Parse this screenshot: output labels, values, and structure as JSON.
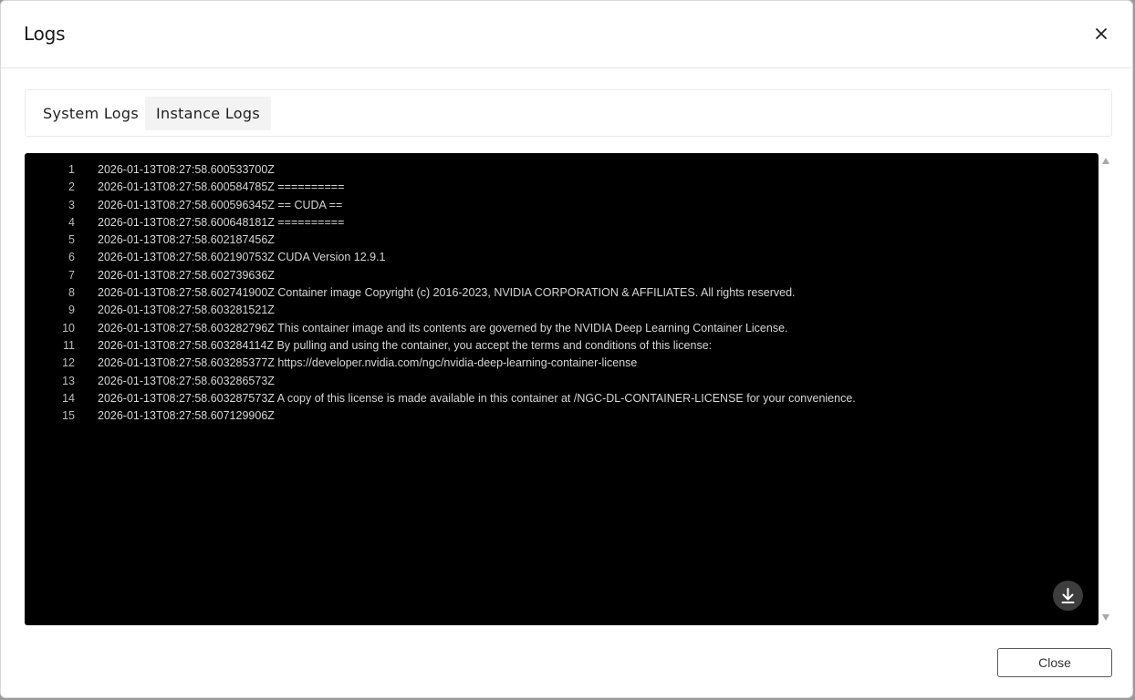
{
  "dialog": {
    "title": "Logs",
    "close_icon": "close-icon"
  },
  "tabs": [
    {
      "label": "System Logs",
      "active": false
    },
    {
      "label": "Instance Logs",
      "active": true
    }
  ],
  "console": {
    "lines": [
      {
        "n": "1",
        "text": "2026-01-13T08:27:58.600533700Z"
      },
      {
        "n": "2",
        "text": "2026-01-13T08:27:58.600584785Z =========="
      },
      {
        "n": "3",
        "text": "2026-01-13T08:27:58.600596345Z == CUDA =="
      },
      {
        "n": "4",
        "text": "2026-01-13T08:27:58.600648181Z =========="
      },
      {
        "n": "5",
        "text": "2026-01-13T08:27:58.602187456Z"
      },
      {
        "n": "6",
        "text": "2026-01-13T08:27:58.602190753Z CUDA Version 12.9.1"
      },
      {
        "n": "7",
        "text": "2026-01-13T08:27:58.602739636Z"
      },
      {
        "n": "8",
        "text": "2026-01-13T08:27:58.602741900Z Container image Copyright (c) 2016-2023, NVIDIA CORPORATION & AFFILIATES. All rights reserved."
      },
      {
        "n": "9",
        "text": "2026-01-13T08:27:58.603281521Z"
      },
      {
        "n": "10",
        "text": "2026-01-13T08:27:58.603282796Z This container image and its contents are governed by the NVIDIA Deep Learning Container License."
      },
      {
        "n": "11",
        "text": "2026-01-13T08:27:58.603284114Z By pulling and using the container, you accept the terms and conditions of this license:"
      },
      {
        "n": "12",
        "text": "2026-01-13T08:27:58.603285377Z https://developer.nvidia.com/ngc/nvidia-deep-learning-container-license"
      },
      {
        "n": "13",
        "text": "2026-01-13T08:27:58.603286573Z"
      },
      {
        "n": "14",
        "text": "2026-01-13T08:27:58.603287573Z A copy of this license is made available in this container at /NGC-DL-CONTAINER-LICENSE for your convenience."
      },
      {
        "n": "15",
        "text": "2026-01-13T08:27:58.607129906Z"
      }
    ],
    "download_icon": "download-icon"
  },
  "footer": {
    "close_label": "Close"
  },
  "colors": {
    "console_bg": "#000000",
    "console_text": "#d6d6d6",
    "active_tab_bg": "#f3f3f3"
  }
}
